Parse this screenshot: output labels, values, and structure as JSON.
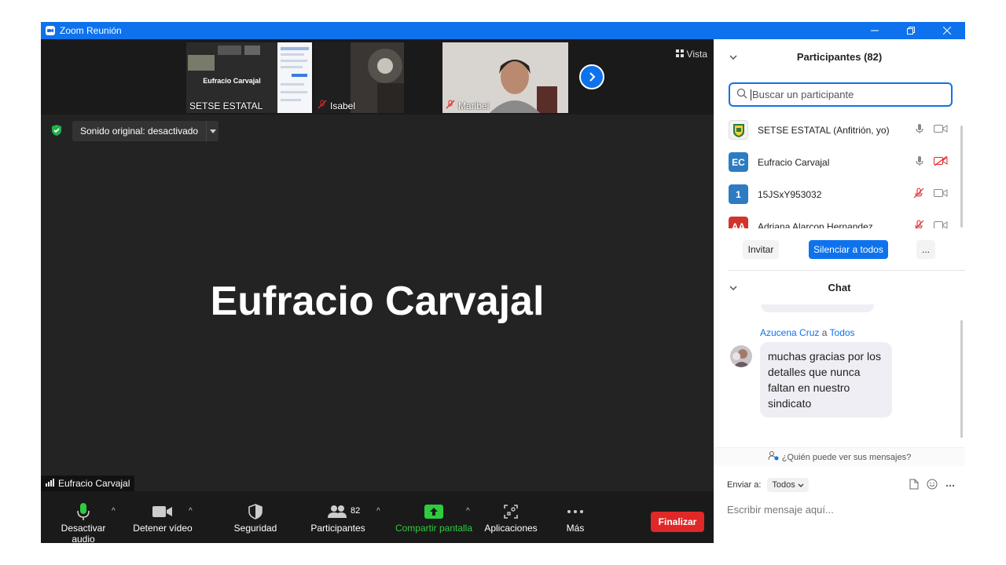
{
  "window": {
    "title": "Zoom Reunión"
  },
  "thumbnails": [
    {
      "name": "SETSE ESTATAL",
      "share_title": "Eufracio Carvajal",
      "muted": false
    },
    {
      "name": "Isabel",
      "muted": true
    },
    {
      "name": "Maribel",
      "muted": true
    }
  ],
  "view_button": "Vista",
  "sound": {
    "label": "Sonido original: desactivado"
  },
  "stage": {
    "active_speaker": "Eufracio Carvajal",
    "speaker_tag": "Eufracio Carvajal"
  },
  "toolbar": {
    "audio": "Desactivar audio",
    "video": "Detener vídeo",
    "security": "Seguridad",
    "participants": "Participantes",
    "participants_count": "82",
    "share": "Compartir pantalla",
    "apps": "Aplicaciones",
    "more": "Más",
    "end": "Finalizar"
  },
  "participants_panel": {
    "title": "Participantes (82)",
    "search_placeholder": "Buscar un participante",
    "list": [
      {
        "name": "SETSE ESTATAL (Anfitrión, yo)",
        "initials": "",
        "color": "#f2f2f2",
        "mic": "on",
        "cam": "on"
      },
      {
        "name": "Eufracio Carvajal",
        "initials": "EC",
        "color": "#2d7cc1",
        "mic": "on",
        "cam": "off"
      },
      {
        "name": "15JSxY953032",
        "initials": "1",
        "color": "#2d7cc1",
        "mic": "muted",
        "cam": "on"
      },
      {
        "name": "Adriana Alarcon Hernandez",
        "initials": "AA",
        "color": "#d0342c",
        "mic": "muted",
        "cam": "on"
      }
    ],
    "invite": "Invitar",
    "mute_all": "Silenciar a todos",
    "more": "..."
  },
  "chat": {
    "title": "Chat",
    "sender": "Azucena Cruz",
    "to_word": "a",
    "recipient": "Todos",
    "message": "muchas gracias por los detalles que nunca faltan en nuestro sindicato",
    "who_can_see": "¿Quién puede ver sus mensajes?",
    "send_to_label": "Enviar a:",
    "send_to_value": "Todos",
    "compose_placeholder": "Escribir mensaje aquí..."
  },
  "colors": {
    "zoom_blue": "#0e72ed",
    "end_red": "#e02828",
    "share_green": "#2ecc40",
    "mute_red": "#e02828"
  }
}
